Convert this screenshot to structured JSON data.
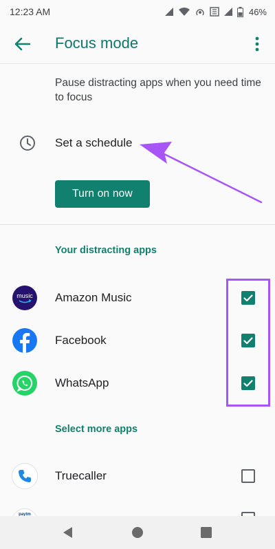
{
  "status_bar": {
    "time": "12:23 AM",
    "battery": "46%",
    "icons": [
      "signal-icon",
      "wifi-icon",
      "hotspot-icon",
      "data-icon",
      "cell-signal-icon",
      "battery-icon"
    ]
  },
  "app_bar": {
    "title": "Focus mode",
    "back_icon": "arrow-back-icon",
    "more_icon": "more-vert-icon"
  },
  "description": "Pause distracting apps when you need time to focus",
  "schedule": {
    "label": "Set a schedule",
    "icon": "clock-icon"
  },
  "turn_on_button": "Turn on now",
  "distracting_section": {
    "header": "Your distracting apps",
    "apps": [
      {
        "name": "Amazon Music",
        "icon_text": "music",
        "checked": true
      },
      {
        "name": "Facebook",
        "checked": true
      },
      {
        "name": "WhatsApp",
        "checked": true
      }
    ]
  },
  "more_section": {
    "header": "Select more apps",
    "apps": [
      {
        "name": "Truecaller",
        "checked": false
      },
      {
        "name": "",
        "icon_text": "paytm",
        "checked": false
      }
    ]
  },
  "annotations": {
    "accent_color": "#a855f7"
  },
  "nav_bar": {
    "back": "nav-back-icon",
    "home": "nav-home-icon",
    "recents": "nav-recents-icon"
  },
  "colors": {
    "primary": "#12806f",
    "title": "#0f766e",
    "background": "#fafafa"
  }
}
